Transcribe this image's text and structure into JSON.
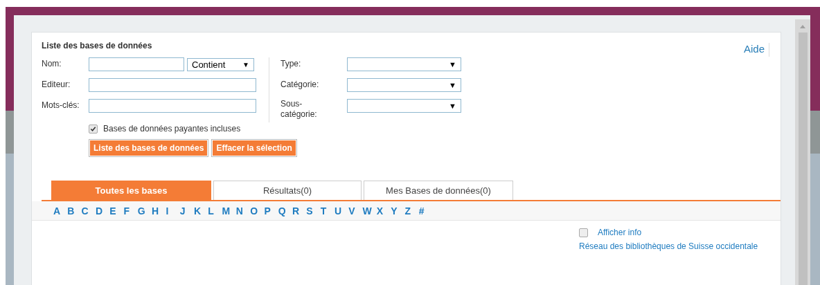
{
  "panel": {
    "title": "Liste des bases de données",
    "help_link": "Aide"
  },
  "form": {
    "left_fields": [
      {
        "label": "Nom:",
        "kind": "text-with-mode",
        "mode": "Contient",
        "mode_arrow": "▼"
      },
      {
        "label": "Editeur:",
        "kind": "text"
      },
      {
        "label": "Mots-clés:",
        "kind": "text"
      }
    ],
    "right_fields": [
      {
        "label": "Type:",
        "arrow": "▼"
      },
      {
        "label": "Catégorie:",
        "arrow": "▼"
      },
      {
        "label": "Sous-catégorie:",
        "arrow": "▼"
      }
    ],
    "checkbox": {
      "label": "Bases de données payantes incluses",
      "checked": true
    },
    "buttons": [
      "Liste des bases de données",
      "Effacer la sélection"
    ]
  },
  "tabs": [
    {
      "label": "Toutes les bases",
      "selected": true
    },
    {
      "label": "Résultats(0)",
      "selected": false
    },
    {
      "label": "Mes Bases de données(0)",
      "selected": false
    }
  ],
  "letters": [
    "A",
    "B",
    "C",
    "D",
    "E",
    "F",
    "G",
    "H",
    "I",
    "J",
    "K",
    "L",
    "M",
    "N",
    "O",
    "P",
    "Q",
    "R",
    "S",
    "T",
    "U",
    "V",
    "W",
    "X",
    "Y",
    "Z",
    "#"
  ],
  "info": {
    "label": "Afficher info",
    "checked": false
  },
  "network_link": "Réseau des bibliothèques de Suisse occidentale"
}
